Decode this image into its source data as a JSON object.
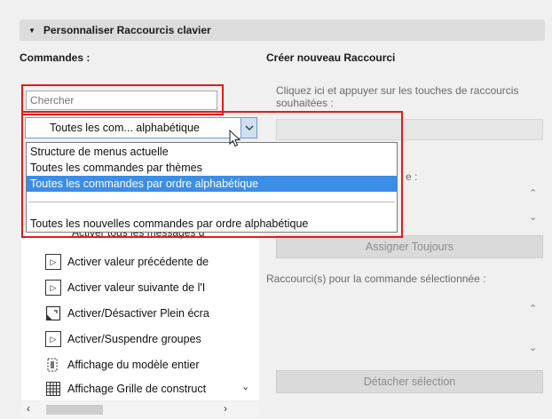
{
  "panel": {
    "title": "Personnaliser Raccourcis clavier"
  },
  "commands": {
    "label": "Commandes :",
    "search_placeholder": "Chercher",
    "dropdown_value": "Toutes les com... alphabétique",
    "dropdown_options": [
      "Structure de menus actuelle",
      "Toutes les commandes par thèmes",
      "Toutes les commandes par ordre alphabétique",
      "Toutes les nouvelles commandes par ordre alphabétique"
    ],
    "selected_option_index": 2,
    "list_items": [
      {
        "label": "Activer tous les messages d'",
        "icon": "cut-off"
      },
      {
        "label": "Activer valeur précédente de",
        "icon": "play-box-icon"
      },
      {
        "label": "Activer valeur suivante de l'I",
        "icon": "play-box-icon"
      },
      {
        "label": "Activer/Désactiver Plein écra",
        "icon": "fullscreen-icon"
      },
      {
        "label": "Activer/Suspendre groupes",
        "icon": "play-box-icon"
      },
      {
        "label": "Affichage du modèle entier",
        "icon": "fit-model-icon"
      },
      {
        "label": "Affichage Grille de construct",
        "icon": "grid-icon"
      }
    ]
  },
  "new_shortcut": {
    "label": "Créer nouveau Raccourci",
    "hint": "Cliquez ici et appuyer sur les touches de raccourcis souhaitées :",
    "partial_label": "e :",
    "assign_button": "Assigner Toujours",
    "selected_label": "Raccourci(s) pour la commande sélectionnée :",
    "detach_button": "Détacher sélection"
  },
  "colors": {
    "highlight_red": "#e01c1c",
    "selection_blue": "#3c8de6"
  }
}
